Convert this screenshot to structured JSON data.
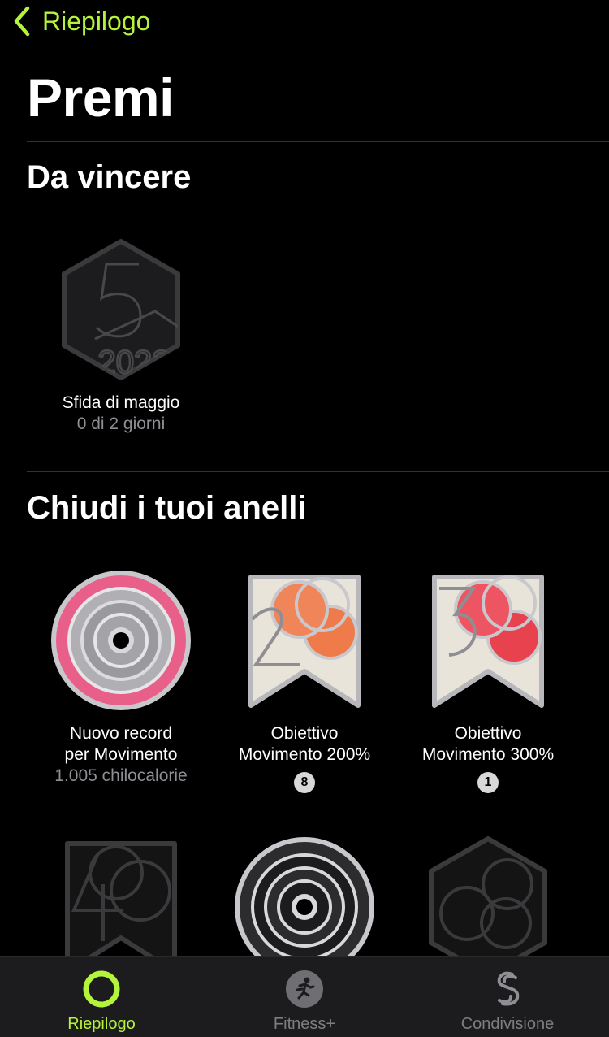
{
  "nav": {
    "back_label": "Riepilogo"
  },
  "page": {
    "title": "Premi"
  },
  "sections": [
    {
      "title": "Da vincere",
      "awards": [
        {
          "name": "Sfida di maggio",
          "subtitle": "0 di 2 giorni"
        }
      ]
    },
    {
      "title": "Chiudi i tuoi anelli",
      "awards": [
        {
          "name": "Nuovo record\nper Movimento",
          "subtitle": "1.005 chilocalorie"
        },
        {
          "name": "Obiettivo\nMovimento 200%",
          "count": "8"
        },
        {
          "name": "Obiettivo\nMovimento 300%",
          "count": "1"
        }
      ]
    }
  ],
  "tabbar": {
    "tabs": [
      {
        "label": "Riepilogo",
        "active": true
      },
      {
        "label": "Fitness+",
        "active": false
      },
      {
        "label": "Condivisione",
        "active": false
      }
    ]
  },
  "colors": {
    "accent": "#b5f33c",
    "move_pink": "#e8608a",
    "move_orange": "#ef7b4b",
    "move_red": "#e8424f"
  }
}
